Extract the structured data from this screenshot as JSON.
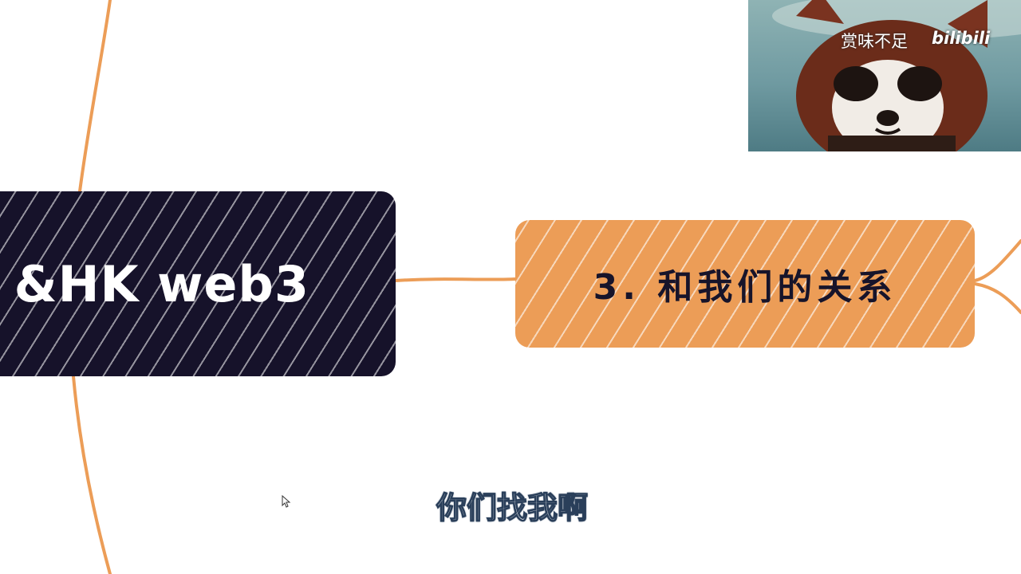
{
  "mindmap": {
    "left_node": {
      "label": "&HK web3"
    },
    "right_node": {
      "label": "3. 和我们的关系"
    }
  },
  "webcam": {
    "caption": "赏味不足",
    "logo": "bilibili"
  },
  "subtitle": {
    "text": "你们找我啊"
  },
  "colors": {
    "branch_orange": "#ec9d57",
    "dark_node": "#16122a",
    "text_dark": "#17142a"
  },
  "icons": {
    "mouse_cursor": "mouse-pointer-icon",
    "red_panda": "red-panda-avatar"
  }
}
